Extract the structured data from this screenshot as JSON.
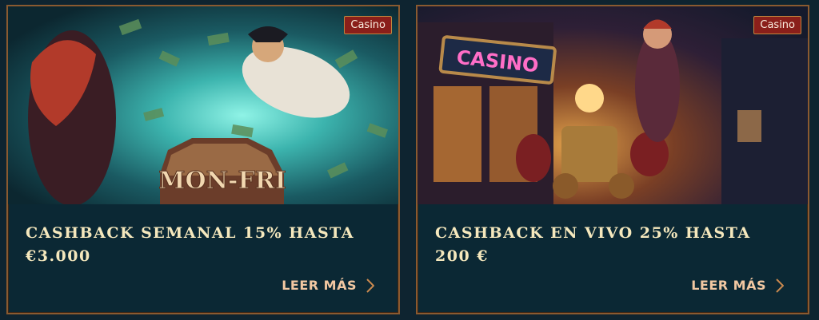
{
  "cards": [
    {
      "category": "Casino",
      "title": "CASHBACK SEMANAL 15% HASTA €3.000",
      "image_text": "MON-FRI",
      "read_more": "LEER MÁS"
    },
    {
      "category": "Casino",
      "title": "CASHBACK EN VIVO 25% HASTA 200 €",
      "image_text": "CASINO",
      "read_more": "LEER MÁS"
    }
  ],
  "colors": {
    "background": "#0e2430",
    "card_border": "#8a5a30",
    "badge_bg": "#8a1f1a",
    "title_text": "#f5e8bd",
    "link_text": "#f2c8a2"
  }
}
